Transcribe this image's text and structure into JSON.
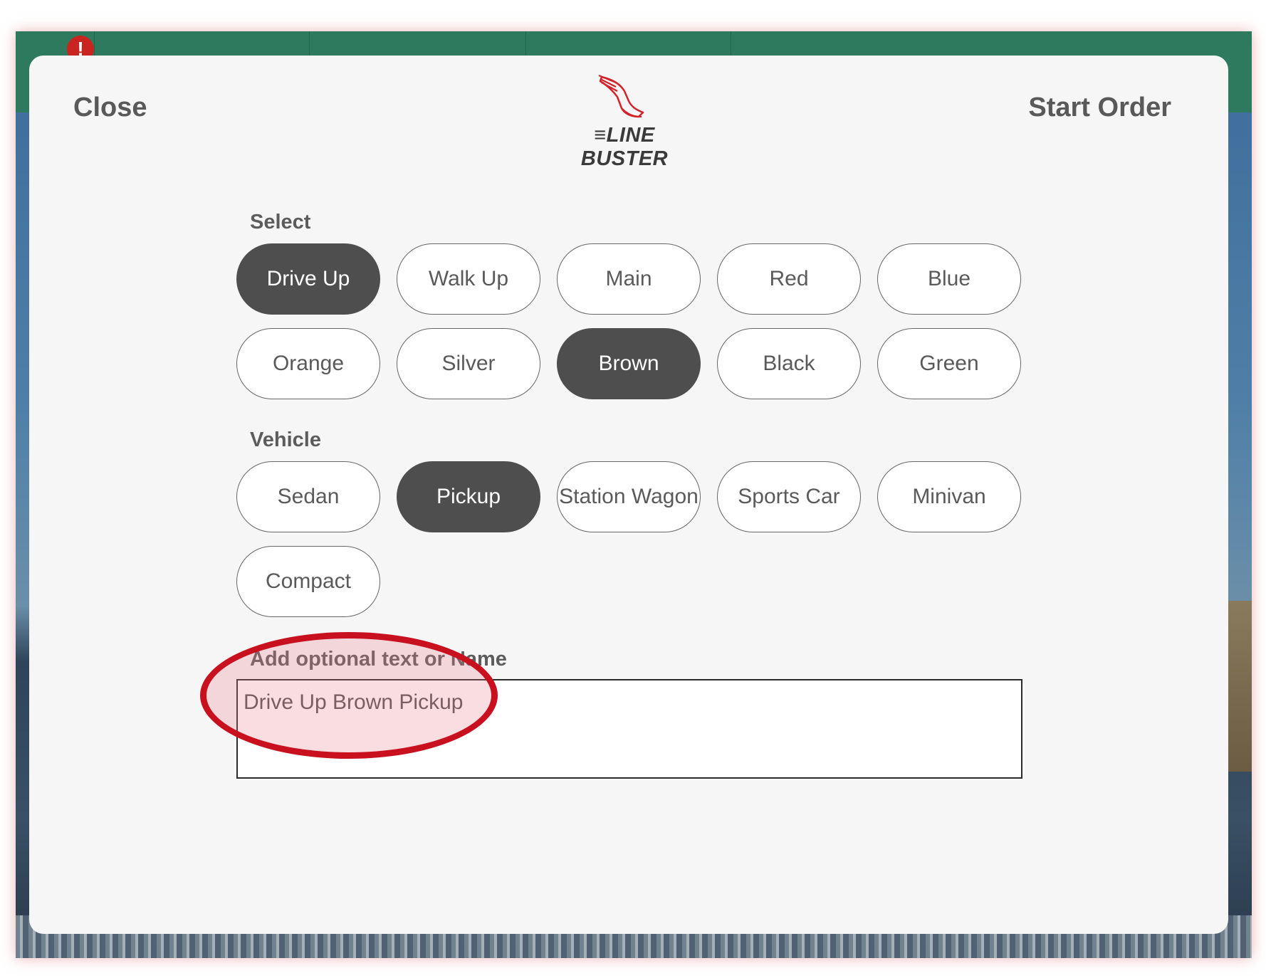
{
  "header": {
    "close_label": "Close",
    "start_label": "Start Order",
    "logo_lines": "≡",
    "logo_text": "LINE BUSTER"
  },
  "alert_badge": "!",
  "select_section": {
    "label": "Select",
    "options": [
      {
        "label": "Drive Up",
        "selected": true
      },
      {
        "label": "Walk Up",
        "selected": false
      },
      {
        "label": "Main",
        "selected": false
      },
      {
        "label": "Red",
        "selected": false
      },
      {
        "label": "Blue",
        "selected": false
      },
      {
        "label": "Orange",
        "selected": false
      },
      {
        "label": "Silver",
        "selected": false
      },
      {
        "label": "Brown",
        "selected": true
      },
      {
        "label": "Black",
        "selected": false
      },
      {
        "label": "Green",
        "selected": false
      }
    ]
  },
  "vehicle_section": {
    "label": "Vehicle",
    "options": [
      {
        "label": "Sedan",
        "selected": false
      },
      {
        "label": "Pickup",
        "selected": true
      },
      {
        "label": "Station Wagon",
        "selected": false
      },
      {
        "label": "Sports Car",
        "selected": false
      },
      {
        "label": "Minivan",
        "selected": false
      },
      {
        "label": "Compact",
        "selected": false
      }
    ]
  },
  "optional_text": {
    "label": "Add optional text or Name",
    "value": "Drive Up Brown Pickup"
  },
  "colors": {
    "selected_pill": "#4e4e4e",
    "annotation": "#c8101e",
    "topbar": "#2e7a5f"
  },
  "icons": {
    "logo": "winged-foot-icon",
    "alert": "alert-icon"
  }
}
